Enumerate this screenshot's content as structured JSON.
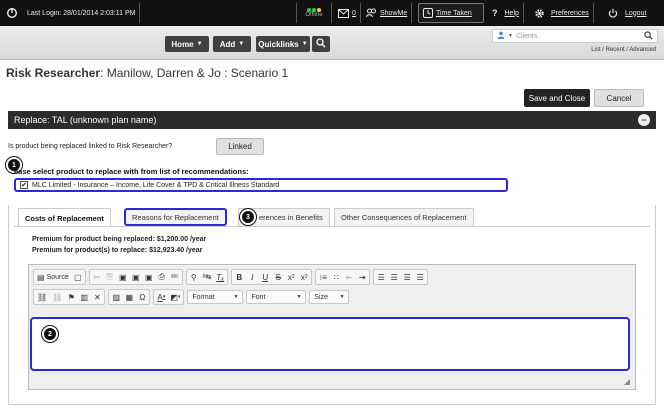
{
  "topbar": {
    "last_login": "Last Login: 28/01/2014 2:03:11 PM",
    "offline": "Offline",
    "mail_count": "0",
    "showme": "ShowMe",
    "time_taken": "Time Taken",
    "help": "Help",
    "preferences": "Preferences",
    "logout": "Logout"
  },
  "header": {
    "home": "Home",
    "add": "Add",
    "quicklinks": "Quicklinks",
    "clients_placeholder": "Clients",
    "list_recent": "List / Recent / Advanced"
  },
  "page": {
    "title_bold": "Risk Researcher",
    "title_rest": ": Manilow, Darren & Jo : Scenario 1",
    "save_close": "Save and Close",
    "cancel": "Cancel"
  },
  "panel": {
    "title": "Replace: TAL (unknown plan name)",
    "linked_question": "Is product being replaced linked to Risk Researcher?",
    "linked_button": "Linked",
    "select_label": "ease select product to replace with from list of recommendations:",
    "recommendation": "MLC Limited - Insurance – Income, Life Cover & TPD & Critical Illness Standard"
  },
  "tabs": [
    {
      "label": "Costs of Replacement"
    },
    {
      "label": "Reasons for Replacement"
    },
    {
      "label": "erences in Benefits"
    },
    {
      "label": "Other Consequences of Replacement"
    }
  ],
  "premiums": {
    "replaced": "Premium for product being replaced: $1,200.00 /year",
    "replace": "Premium for product(s) to replace:   $12,923.40 /year"
  },
  "editor": {
    "source": "Source",
    "format": "Format",
    "font": "Font",
    "size": "Size"
  },
  "steps": [
    "1",
    "2",
    "3"
  ]
}
